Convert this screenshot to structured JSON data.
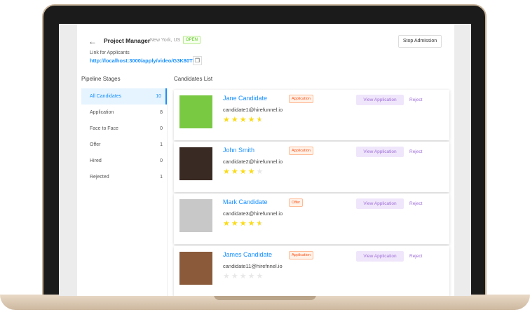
{
  "header": {
    "back_icon": "arrow-left-icon",
    "title": "Project Manager",
    "location": "New York, US",
    "status": "OPEN",
    "stop_label": "Stop Admission",
    "link_label": "Link for Applicants",
    "link": "http://localhost:3000/apply/video/G3K80Tl",
    "copy_icon": "copy-icon"
  },
  "sidebar": {
    "title": "Pipeline Stages",
    "items": [
      {
        "label": "All Candidates",
        "count": "10"
      },
      {
        "label": "Application",
        "count": "8"
      },
      {
        "label": "Face to Face",
        "count": "0"
      },
      {
        "label": "Offer",
        "count": "1"
      },
      {
        "label": "Hired",
        "count": "0"
      },
      {
        "label": "Rejected",
        "count": "1"
      }
    ]
  },
  "candidates": {
    "title": "Candidates List",
    "view_label": "View Application",
    "reject_label": "Reject",
    "items": [
      {
        "name": "Jane Candidate",
        "email": "candidate1@hirefunnel.io",
        "stage": "Application",
        "rating": 4.5,
        "photo_bg": "#7ac943"
      },
      {
        "name": "John Smith",
        "email": "candidate2@hirefunnel.io",
        "stage": "Application",
        "rating": 4,
        "photo_bg": "#3a2a24"
      },
      {
        "name": "Mark Candidate",
        "email": "candidate3@hirefunnel.io",
        "stage": "Offer",
        "rating": 4.5,
        "photo_bg": "#c8c8c8"
      },
      {
        "name": "James Candidate",
        "email": "candidate11@hirefnnel.io",
        "stage": "Application",
        "rating": 0,
        "photo_bg": "#8a5a3a"
      }
    ]
  },
  "colors": {
    "accent": "#1890ff",
    "purple": "#9f6fd8",
    "star": "#fadb14"
  }
}
